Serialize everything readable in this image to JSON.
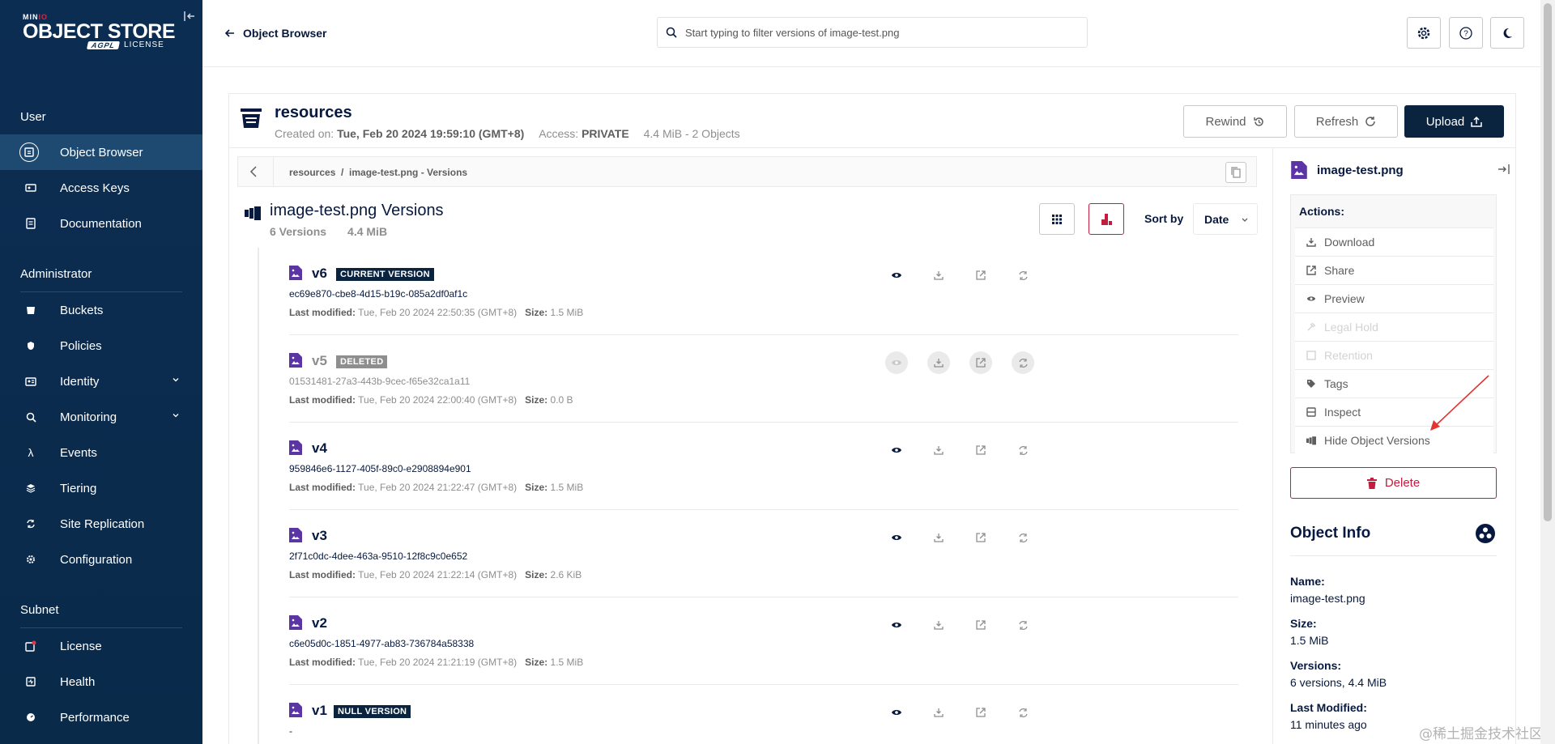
{
  "sidebar": {
    "brand": {
      "mini": "MIN",
      "io": "IO",
      "product": "OBJECT STORE",
      "agpl": "AGPL",
      "license": "LICENSE"
    },
    "sections": {
      "user": "User",
      "admin": "Administrator",
      "subnet": "Subnet"
    },
    "items": {
      "object_browser": "Object Browser",
      "access_keys": "Access Keys",
      "documentation": "Documentation",
      "buckets": "Buckets",
      "policies": "Policies",
      "identity": "Identity",
      "monitoring": "Monitoring",
      "events": "Events",
      "tiering": "Tiering",
      "site_replication": "Site Replication",
      "configuration": "Configuration",
      "license": "License",
      "health": "Health",
      "performance": "Performance"
    }
  },
  "topbar": {
    "back_label": "Object Browser",
    "search_placeholder": "Start typing to filter versions of image-test.png"
  },
  "bucket": {
    "name": "resources",
    "created_label": "Created on:",
    "created_value": "Tue, Feb 20 2024 19:59:10 (GMT+8)",
    "access_label": "Access:",
    "access_value": "PRIVATE",
    "size_summary": "4.4 MiB - 2 Objects",
    "rewind": "Rewind",
    "refresh": "Refresh",
    "upload": "Upload"
  },
  "breadcrumb": {
    "text": "resources  /  image-test.png - Versions"
  },
  "versions_header": {
    "title": "image-test.png Versions",
    "count": "6 Versions",
    "size": "4.4 MiB",
    "sort_label": "Sort by",
    "sort_value": "Date"
  },
  "versions": [
    {
      "name": "v6",
      "badge": "CURRENT VERSION",
      "id": "ec69e870-cbe8-4d15-b19c-085a2df0af1c",
      "lm_label": "Last modified:",
      "lm": "Tue, Feb 20 2024 22:50:35 (GMT+8)",
      "size_label": "Size:",
      "size": "1.5 MiB"
    },
    {
      "name": "v5",
      "badge": "DELETED",
      "id": "01531481-27a3-443b-9cec-f65e32ca1a11",
      "lm_label": "Last modified:",
      "lm": "Tue, Feb 20 2024 22:00:40 (GMT+8)",
      "size_label": "Size:",
      "size": "0.0 B"
    },
    {
      "name": "v4",
      "badge": "",
      "id": "959846e6-1127-405f-89c0-e2908894e901",
      "lm_label": "Last modified:",
      "lm": "Tue, Feb 20 2024 21:22:47 (GMT+8)",
      "size_label": "Size:",
      "size": "1.5 MiB"
    },
    {
      "name": "v3",
      "badge": "",
      "id": "2f71c0dc-4dee-463a-9510-12f8c9c0e652",
      "lm_label": "Last modified:",
      "lm": "Tue, Feb 20 2024 21:22:14 (GMT+8)",
      "size_label": "Size:",
      "size": "2.6 KiB"
    },
    {
      "name": "v2",
      "badge": "",
      "id": "c6e05d0c-1851-4977-ab83-736784a58338",
      "lm_label": "Last modified:",
      "lm": "Tue, Feb 20 2024 21:21:19 (GMT+8)",
      "size_label": "Size:",
      "size": "1.5 MiB"
    },
    {
      "name": "v1",
      "badge": "NULL VERSION",
      "id": "-",
      "lm_label": "",
      "lm": "",
      "size_label": "",
      "size": ""
    }
  ],
  "panel": {
    "file_name": "image-test.png",
    "actions_title": "Actions:",
    "actions": {
      "download": "Download",
      "share": "Share",
      "preview": "Preview",
      "legal_hold": "Legal Hold",
      "retention": "Retention",
      "tags": "Tags",
      "inspect": "Inspect",
      "hide_versions": "Hide Object Versions"
    },
    "delete": "Delete",
    "object_info_title": "Object Info",
    "info": {
      "name_label": "Name:",
      "name": "image-test.png",
      "size_label": "Size:",
      "size": "1.5 MiB",
      "versions_label": "Versions:",
      "versions": "6 versions, 4.4 MiB",
      "modified_label": "Last Modified:",
      "modified": "11 minutes ago"
    }
  },
  "watermark": "@稀土掘金技术社区",
  "colors": {
    "sidebar": "#0c2d52",
    "primary": "#0a2440",
    "danger": "#c51b3f",
    "file_icon": "#5c35a5"
  }
}
